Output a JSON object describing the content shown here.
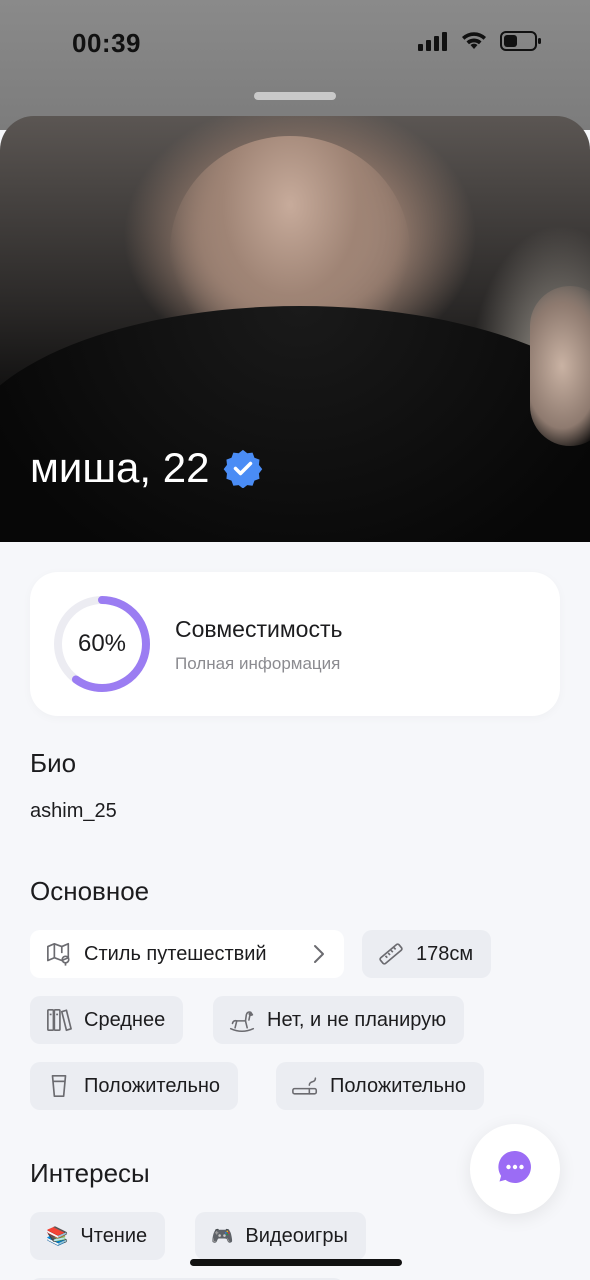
{
  "status": {
    "time": "00:39",
    "icons": [
      "signal-icon",
      "wifi-icon",
      "battery-icon"
    ]
  },
  "profile": {
    "name_age": "миша, 22",
    "verified": true,
    "badge_color": "#4a8cf5"
  },
  "compatibility": {
    "percent_label": "60%",
    "percent_value": 0.6,
    "title": "Совместимость",
    "subtitle": "Полная информация",
    "ring_color": "#9b7df2",
    "track_color": "#ececf2"
  },
  "bio": {
    "title": "Био",
    "text": "ashim_25"
  },
  "basics": {
    "title": "Основное",
    "chips": [
      {
        "label": "Стиль путешествий",
        "icon": "map-pin-icon"
      },
      {
        "label": "178см",
        "icon": "ruler-icon"
      },
      {
        "label": "Среднее",
        "icon": "books-icon"
      },
      {
        "label": "Нет, и не планирую",
        "icon": "rocking-horse-icon"
      },
      {
        "label": "Положительно",
        "icon": "glass-icon"
      },
      {
        "label": "Положительно",
        "icon": "cigarette-icon"
      }
    ]
  },
  "interests": {
    "title": "Интересы",
    "chips": [
      {
        "label": "Чтение",
        "emoji": "📚"
      },
      {
        "label": "Видеоигры",
        "emoji": "🎮"
      }
    ]
  },
  "fab": {
    "icon": "chat-bubble-icon",
    "color": "#9b6cf5"
  }
}
